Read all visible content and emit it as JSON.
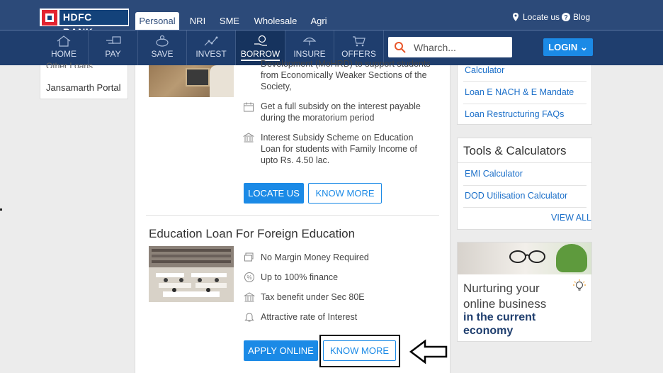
{
  "header": {
    "brand": "HDFC BANK",
    "segments": [
      "Personal",
      "NRI",
      "SME",
      "Wholesale",
      "Agri"
    ],
    "active_segment": "Personal",
    "utilities": {
      "locate": "Locate us",
      "blog": "Blog"
    }
  },
  "nav": {
    "items": [
      "HOME",
      "PAY",
      "SAVE",
      "INVEST",
      "BORROW",
      "INSURE",
      "OFFERS"
    ],
    "active": "BORROW",
    "search_value": "Wharch...",
    "login_label": "LOGIN"
  },
  "left_sidebar": {
    "cut_item": "Other Loans",
    "items": [
      "Jansamarth Portal"
    ]
  },
  "main": {
    "loan1": {
      "features": [
        "Development (MoHRD) to support students from Economically Weaker Sections of the Society,",
        "Get a full subsidy on the interest payable during the moratorium period",
        "Interest Subsidy Scheme on Education Loan for students with Family Income of upto Rs. 4.50 lac."
      ],
      "locate_label": "LOCATE US",
      "know_more_label": "KNOW MORE"
    },
    "loan2": {
      "title": "Education Loan For Foreign Education",
      "features": [
        "No Margin Money Required",
        "Up to 100% finance",
        "Tax benefit under Sec 80E",
        "Attractive rate of Interest"
      ],
      "apply_label": "APPLY ONLINE",
      "know_more_label": "KNOW MORE"
    }
  },
  "right_sidebar": {
    "links_top": [
      "Calculator",
      "Loan E NACH & E Mandate",
      "Loan Restructuring FAQs"
    ],
    "tools": {
      "title": "Tools & Calculators",
      "links": [
        "EMI Calculator",
        "DOD Utilisation Calculator"
      ],
      "view_all": "VIEW ALL"
    },
    "promo": {
      "line1": "Nurturing your",
      "line2": "online business",
      "line3": "in the current",
      "line4": "economy"
    }
  },
  "colors": {
    "header_bg": "#2c4a79",
    "nav_bg": "#1f3e6e",
    "accent": "#1b8ae6",
    "link": "#1b6fc9",
    "brand_red": "#e3232f"
  }
}
